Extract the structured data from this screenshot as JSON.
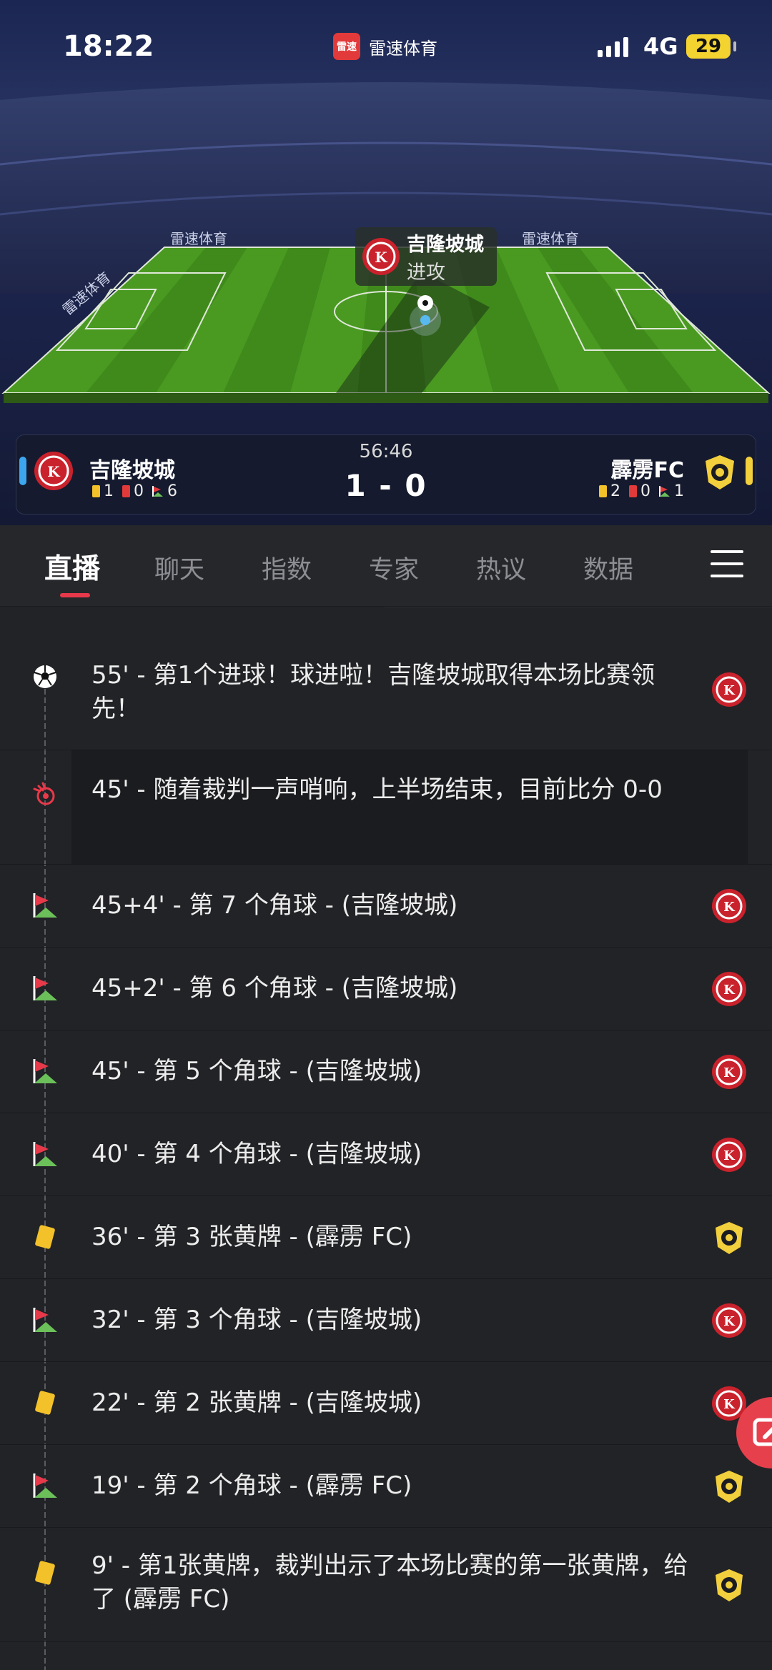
{
  "status_bar": {
    "time": "18:22",
    "app_name": "雷速体育",
    "app_logo_text": "雷速",
    "network": "4G",
    "battery": "29"
  },
  "event_popup": {
    "team": "吉隆坡城",
    "action": "进攻"
  },
  "pitch_banners": [
    "雷速体育",
    "雷速体育",
    "雷速体育"
  ],
  "scoreboard": {
    "clock": "56:46",
    "score": "1 - 0",
    "home": {
      "name": "吉隆坡城",
      "yellow": "1",
      "red": "0",
      "corners": "6"
    },
    "away": {
      "name": "霹雳FC",
      "yellow": "2",
      "red": "0",
      "corners": "1"
    }
  },
  "tabs": [
    {
      "label": "直播",
      "active": true
    },
    {
      "label": "聊天"
    },
    {
      "label": "指数"
    },
    {
      "label": "专家"
    },
    {
      "label": "热议"
    },
    {
      "label": "数据"
    }
  ],
  "events": [
    {
      "icon": "goal",
      "text": "55' - 第1个进球！球进啦！吉隆坡城取得本场比赛领先！",
      "team": "home"
    },
    {
      "icon": "whistle",
      "text": "45' - 随着裁判一声哨响，上半场结束，目前比分 0-0",
      "team": ""
    },
    {
      "icon": "corner",
      "text": "45+4' - 第 7 个角球 - (吉隆坡城)",
      "team": "home"
    },
    {
      "icon": "corner",
      "text": "45+2' - 第 6 个角球 - (吉隆坡城)",
      "team": "home"
    },
    {
      "icon": "corner",
      "text": "45' - 第 5 个角球 - (吉隆坡城)",
      "team": "home"
    },
    {
      "icon": "corner",
      "text": "40' - 第 4 个角球 - (吉隆坡城)",
      "team": "home"
    },
    {
      "icon": "yellow",
      "text": "36' - 第 3 张黄牌 - (霹雳 FC)",
      "team": "away"
    },
    {
      "icon": "corner",
      "text": "32' - 第 3 个角球 - (吉隆坡城)",
      "team": "home"
    },
    {
      "icon": "yellow",
      "text": "22' - 第 2 张黄牌 - (吉隆坡城)",
      "team": "home"
    },
    {
      "icon": "corner",
      "text": "19' - 第 2 个角球 - (霹雳 FC)",
      "team": "away"
    },
    {
      "icon": "yellow",
      "text": "9' - 第1张黄牌，裁判出示了本场比赛的第一张黄牌，给了 (霹雳 FC)",
      "team": "away"
    }
  ],
  "colors": {
    "accent": "#e8394a",
    "home": "#3ca6ee",
    "away": "#f2cf3c",
    "background": "#222326"
  }
}
